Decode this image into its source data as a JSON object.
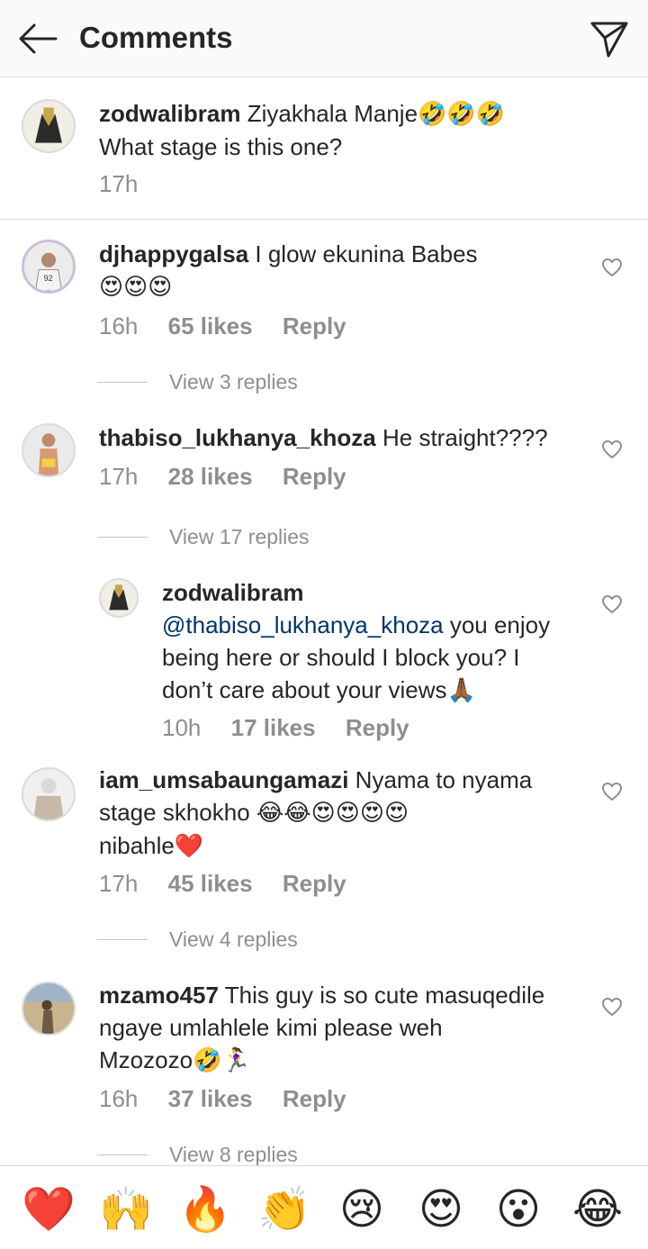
{
  "header": {
    "title": "Comments",
    "back_icon": "arrow-left-icon",
    "send_icon": "paper-plane-icon"
  },
  "caption": {
    "username": "zodwalibram",
    "text": "Ziyakhala Manje",
    "emoji": "🤣🤣🤣",
    "line2": "What stage is this one?",
    "time": "17h"
  },
  "comments": [
    {
      "username": "djhappygalsa",
      "text": "I glow ekunina Babes",
      "emoji_line": "😍😍😍",
      "time": "16h",
      "likes": "65 likes",
      "reply": "Reply",
      "view_replies": "View 3 replies"
    },
    {
      "username": "thabiso_lukhanya_khoza",
      "text": "He straight????",
      "time": "17h",
      "likes": "28 likes",
      "reply": "Reply",
      "view_replies": "View 17 replies"
    },
    {
      "username": "iam_umsabaungamazi",
      "text": "Nyama to nyama",
      "line2": "stage skhokho",
      "line2_emoji": "😂😂😍😍😍😍",
      "line3": "nibahle",
      "line3_emoji": "❤️",
      "time": "17h",
      "likes": "45 likes",
      "reply": "Reply",
      "view_replies": "View 4 replies"
    },
    {
      "username": "mzamo457",
      "text": "This guy is so cute masuqedile",
      "line2": "ngaye umlahlele kimi please weh",
      "line3": "Mzozozo",
      "line3_emoji": "🤣🏃‍♀️",
      "time": "16h",
      "likes": "37 likes",
      "reply": "Reply",
      "view_replies": "View 8 replies"
    }
  ],
  "reply_comment": {
    "username": "zodwalibram",
    "mention": "@thabiso_lukhanya_khoza",
    "text1": " you enjoy",
    "text2": "being here or should I block you? I",
    "text3": "don’t care about your views",
    "emoji": "🙏🏾",
    "time": "10h",
    "likes": "17 likes",
    "reply": "Reply"
  },
  "emoji_bar": [
    "❤️",
    "🙌",
    "🔥",
    "👏",
    "😢",
    "😍",
    "😮",
    "😂"
  ],
  "colors": {
    "text": "#262626",
    "secondary": "#8e8e8e",
    "mention": "#003569",
    "divider": "#dbdbdb"
  }
}
